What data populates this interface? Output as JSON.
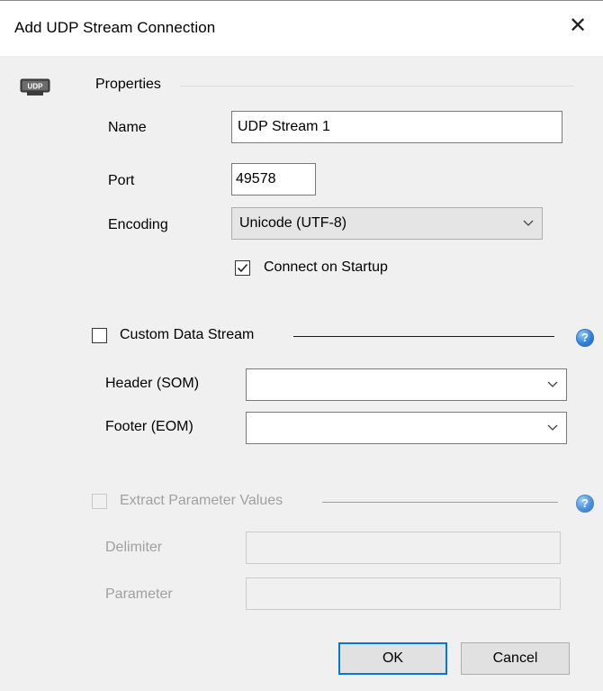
{
  "window": {
    "title": "Add UDP Stream Connection",
    "close_glyph": "✕"
  },
  "icon": {
    "name": "udp-icon",
    "text": "UDP"
  },
  "properties": {
    "section_label": "Properties",
    "name_label": "Name",
    "name_value": "UDP Stream 1",
    "port_label": "Port",
    "port_value": "49578",
    "encoding_label": "Encoding",
    "encoding_value": "Unicode (UTF-8)",
    "connect_on_startup_label": "Connect on Startup",
    "connect_on_startup_checked": true
  },
  "custom_stream": {
    "label": "Custom Data Stream",
    "checked": false,
    "header_label": "Header (SOM)",
    "header_value": "",
    "footer_label": "Footer (EOM)",
    "footer_value": ""
  },
  "extract": {
    "label": "Extract Parameter Values",
    "checked": false,
    "enabled": false,
    "delimiter_label": "Delimiter",
    "delimiter_value": "",
    "parameter_label": "Parameter",
    "parameter_value": ""
  },
  "buttons": {
    "ok": "OK",
    "cancel": "Cancel"
  },
  "colors": {
    "accent": "#0078d7",
    "help": "#2e7fd6",
    "dialog_bg": "#f0f0f0"
  }
}
